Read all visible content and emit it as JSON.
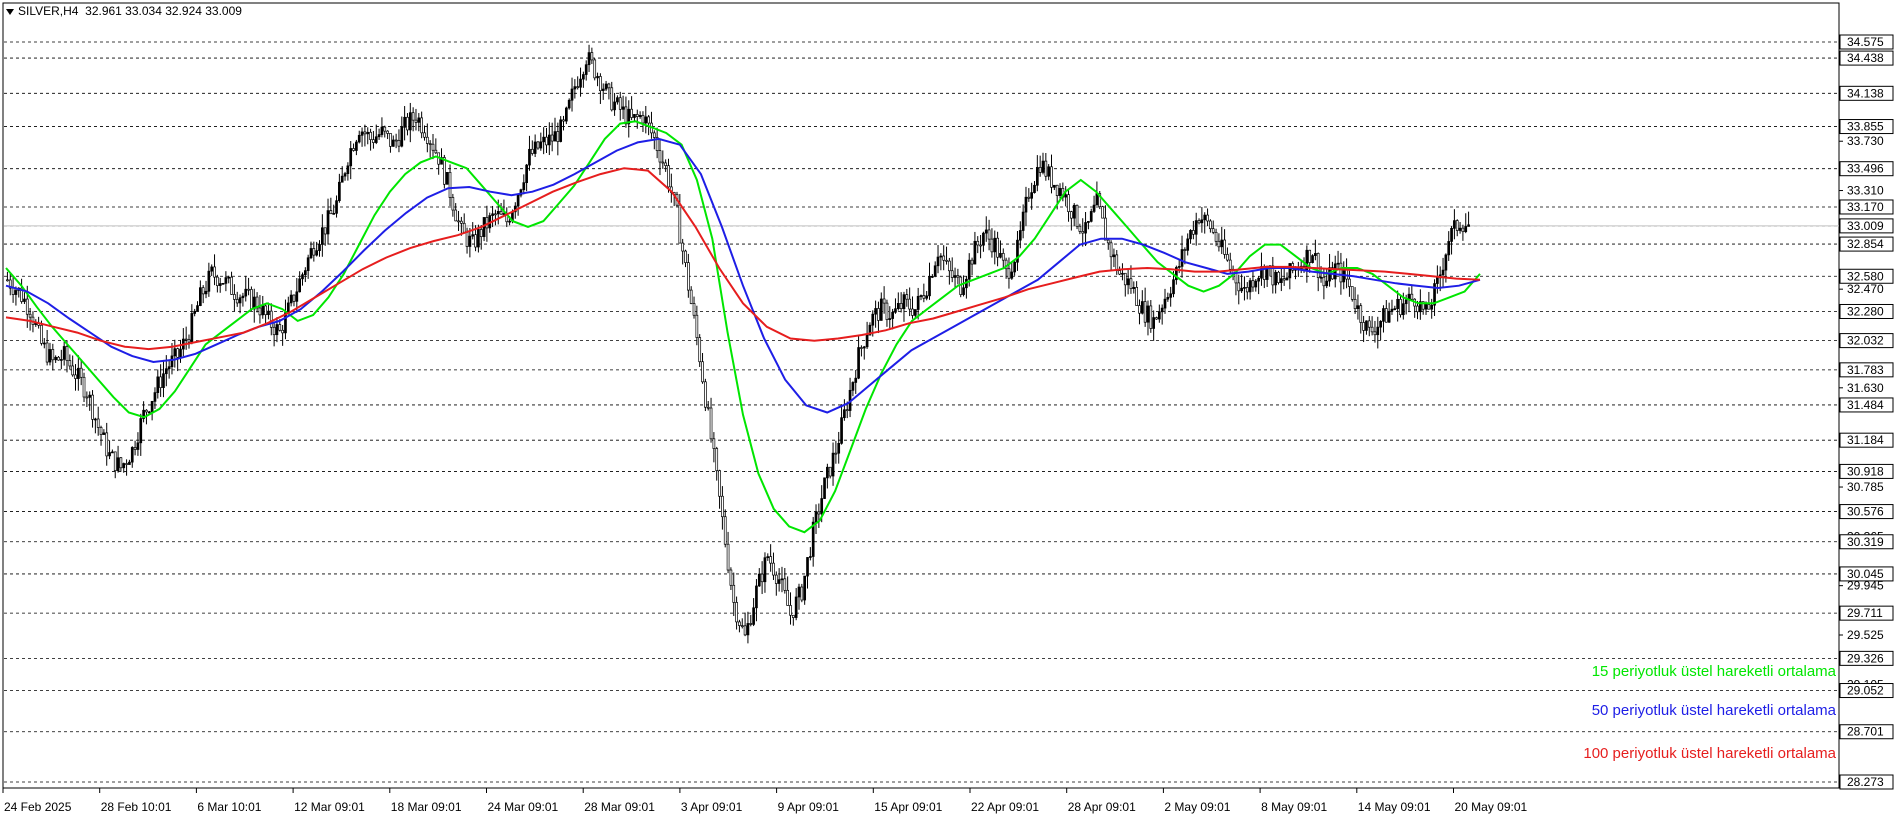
{
  "header": {
    "symbol_label": "SILVER,H4",
    "ohlc": "32.961 33.034 32.924 33.009"
  },
  "legend": [
    {
      "label": "15 periyotluk üstel hareketli ortalama",
      "color": "#00e600"
    },
    {
      "label": "50 periyotluk üstel hareketli ortalama",
      "color": "#1e1ee6"
    },
    {
      "label": "100 periyotluk üstel hareketli ortalama",
      "color": "#e61e1e"
    }
  ],
  "chart_data": {
    "type": "line",
    "symbol": "SILVER",
    "timeframe": "H4",
    "ylim": [
      28.2,
      34.7
    ],
    "x_labels": [
      "24 Feb 2025",
      "28 Feb 10:01",
      "6 Mar 10:01",
      "12 Mar 09:01",
      "18 Mar 09:01",
      "24 Mar 09:01",
      "28 Mar 09:01",
      "3 Apr 09:01",
      "9 Apr 09:01",
      "15 Apr 09:01",
      "22 Apr 09:01",
      "28 Apr 09:01",
      "2 May 09:01",
      "8 May 09:01",
      "14 May 09:01",
      "20 May 09:01"
    ],
    "y_ticks": [
      "34.575",
      "34.438",
      "34.138",
      "33.855",
      "33.730",
      "33.496",
      "33.310",
      "33.170",
      "33.009",
      "32.854",
      "32.580",
      "32.470",
      "32.280",
      "32.032",
      "31.783",
      "31.630",
      "31.484",
      "31.184",
      "30.918",
      "30.785",
      "30.576",
      "30.365",
      "30.319",
      "30.045",
      "29.945",
      "29.711",
      "29.525",
      "29.326",
      "29.105",
      "29.052",
      "28.701",
      "28.273"
    ],
    "y_boxed": [
      "34.575",
      "34.438",
      "34.138",
      "33.855",
      "33.496",
      "33.170",
      "33.009",
      "32.854",
      "32.580",
      "32.280",
      "32.032",
      "31.783",
      "31.484",
      "31.184",
      "30.918",
      "30.576",
      "30.319",
      "30.045",
      "29.711",
      "29.326",
      "29.052",
      "28.701",
      "28.273"
    ],
    "current_price": "33.009",
    "price_series": {
      "name": "SILVER",
      "values": [
        32.55,
        32.45,
        32.3,
        32.0,
        31.85,
        31.9,
        31.75,
        31.6,
        31.3,
        31.05,
        30.95,
        31.1,
        31.4,
        31.6,
        31.8,
        31.9,
        32.1,
        32.4,
        32.6,
        32.55,
        32.45,
        32.4,
        32.35,
        32.2,
        32.1,
        32.35,
        32.6,
        32.85,
        33.0,
        33.2,
        33.6,
        33.85,
        33.75,
        33.8,
        33.7,
        33.85,
        33.95,
        33.8,
        33.6,
        33.3,
        32.95,
        32.85,
        33.0,
        33.1,
        33.05,
        33.3,
        33.6,
        33.7,
        33.75,
        33.85,
        34.2,
        34.45,
        34.3,
        34.1,
        34.0,
        33.9,
        33.95,
        33.75,
        33.5,
        33.1,
        32.5,
        31.9,
        31.2,
        30.5,
        29.8,
        29.5,
        29.9,
        30.2,
        30.0,
        29.7,
        29.9,
        30.4,
        30.8,
        31.1,
        31.5,
        31.9,
        32.2,
        32.3,
        32.25,
        32.35,
        32.3,
        32.5,
        32.8,
        32.6,
        32.5,
        32.75,
        32.95,
        32.85,
        32.6,
        32.8,
        33.3,
        33.55,
        33.4,
        33.3,
        33.1,
        32.95,
        33.2,
        32.85,
        32.6,
        32.5,
        32.3,
        32.2,
        32.4,
        32.6,
        32.9,
        33.1,
        33.0,
        32.8,
        32.6,
        32.45,
        32.6,
        32.65,
        32.5,
        32.6,
        32.7,
        32.8,
        32.5,
        32.65,
        32.55,
        32.3,
        32.1,
        32.2,
        32.3,
        32.35,
        32.4,
        32.25,
        32.5,
        32.9,
        33.05,
        33.0
      ]
    },
    "series": [
      {
        "name": "15 periyotluk üstel hareketli ortalama",
        "color": "#00e600",
        "values": [
          32.65,
          32.5,
          32.32,
          32.15,
          32.0,
          31.85,
          31.7,
          31.55,
          31.42,
          31.38,
          31.45,
          31.6,
          31.8,
          32.0,
          32.1,
          32.2,
          32.3,
          32.35,
          32.3,
          32.2,
          32.25,
          32.4,
          32.6,
          32.85,
          33.1,
          33.3,
          33.45,
          33.55,
          33.6,
          33.55,
          33.5,
          33.35,
          33.2,
          33.05,
          33.0,
          33.05,
          33.2,
          33.35,
          33.55,
          33.75,
          33.88,
          33.9,
          33.85,
          33.8,
          33.7,
          33.4,
          32.9,
          32.1,
          31.4,
          30.9,
          30.6,
          30.45,
          30.4,
          30.5,
          30.75,
          31.1,
          31.45,
          31.75,
          32.0,
          32.2,
          32.3,
          32.4,
          32.5,
          32.55,
          32.6,
          32.65,
          32.75,
          32.9,
          33.1,
          33.3,
          33.4,
          33.3,
          33.15,
          33.0,
          32.85,
          32.7,
          32.6,
          32.5,
          32.45,
          32.5,
          32.6,
          32.75,
          32.85,
          32.85,
          32.75,
          32.65,
          32.6,
          32.65,
          32.65,
          32.6,
          32.5,
          32.4,
          32.35,
          32.35,
          32.4,
          32.45,
          32.6
        ]
      },
      {
        "name": "50 periyotluk üstel hareketli ortalama",
        "color": "#1e1ee6",
        "values": [
          32.5,
          32.45,
          32.35,
          32.22,
          32.1,
          31.98,
          31.9,
          31.85,
          31.87,
          31.92,
          32.0,
          32.08,
          32.15,
          32.2,
          32.3,
          32.45,
          32.62,
          32.8,
          32.97,
          33.12,
          33.25,
          33.33,
          33.34,
          33.3,
          33.27,
          33.3,
          33.36,
          33.45,
          33.55,
          33.65,
          33.72,
          33.75,
          33.7,
          33.45,
          33.0,
          32.5,
          32.05,
          31.7,
          31.48,
          31.42,
          31.5,
          31.65,
          31.8,
          31.95,
          32.05,
          32.15,
          32.25,
          32.35,
          32.45,
          32.55,
          32.7,
          32.85,
          32.9,
          32.9,
          32.85,
          32.78,
          32.7,
          32.65,
          32.6,
          32.62,
          32.65,
          32.65,
          32.62,
          32.6,
          32.58,
          32.55,
          32.52,
          32.5,
          32.48,
          32.5,
          32.55
        ]
      },
      {
        "name": "100 periyotluk üstel hareketli ortalama",
        "color": "#e61e1e",
        "values": [
          32.23,
          32.2,
          32.15,
          32.1,
          32.03,
          31.98,
          31.96,
          31.98,
          32.02,
          32.06,
          32.1,
          32.18,
          32.28,
          32.4,
          32.52,
          32.64,
          32.74,
          32.82,
          32.88,
          32.93,
          33.0,
          33.1,
          33.2,
          33.3,
          33.38,
          33.45,
          33.5,
          33.48,
          33.3,
          33.0,
          32.65,
          32.35,
          32.15,
          32.05,
          32.03,
          32.05,
          32.08,
          32.12,
          32.18,
          32.22,
          32.28,
          32.34,
          32.4,
          32.47,
          32.52,
          32.57,
          32.62,
          32.64,
          32.65,
          32.64,
          32.62,
          32.62,
          32.64,
          32.66,
          32.66,
          32.65,
          32.64,
          32.63,
          32.62,
          32.6,
          32.58,
          32.56,
          32.55
        ]
      }
    ]
  }
}
